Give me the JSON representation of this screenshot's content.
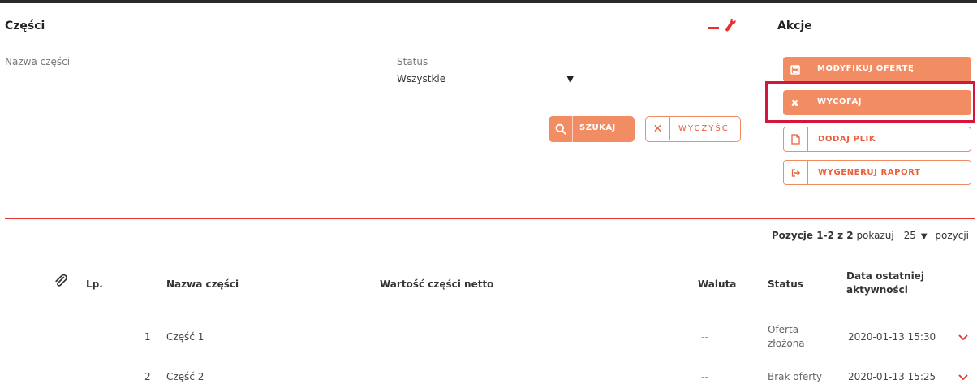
{
  "parts": {
    "title": "Części",
    "part_name_label": "Nazwa części",
    "status_label": "Status",
    "status_value": "Wszystkie",
    "search_label": "SZUKAJ",
    "clear_label": "WYCZYŚĆ"
  },
  "actions": {
    "title": "Akcje",
    "items": [
      {
        "label": "MODYFIKUJ OFERTĘ",
        "icon": "save-icon"
      },
      {
        "label": "WYCOFAJ",
        "icon": "close-icon"
      },
      {
        "label": "DODAJ PLIK",
        "icon": "file-icon"
      },
      {
        "label": "WYGENERUJ RAPORT",
        "icon": "export-icon"
      }
    ]
  },
  "pager": {
    "range": "Pozycje 1-2 z 2",
    "show_label": "pokazuj",
    "page_size": "25",
    "items_label": "pozycji"
  },
  "table": {
    "headers": {
      "attachment_icon": "paperclip-icon",
      "lp": "Lp.",
      "name": "Nazwa części",
      "net_value": "Wartość części netto",
      "currency": "Waluta",
      "status": "Status",
      "last_activity_1": "Data ostatniej",
      "last_activity_2": "aktywności"
    },
    "rows": [
      {
        "lp": "1",
        "name": "Część 1",
        "net_value": "",
        "currency": "--",
        "status_1": "Oferta",
        "status_2": "złożona",
        "date": "2020-01-13 15:30"
      },
      {
        "lp": "2",
        "name": "Część 2",
        "net_value": "",
        "currency": "--",
        "status_1": "Brak oferty",
        "status_2": "",
        "date": "2020-01-13 15:25"
      }
    ]
  },
  "colors": {
    "accent": "#f28c63",
    "divider": "#e53030",
    "highlight": "#d4163c"
  }
}
